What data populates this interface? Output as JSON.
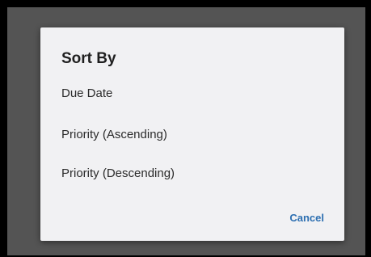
{
  "dialog": {
    "title": "Sort By",
    "options": [
      {
        "label": "Due Date"
      },
      {
        "label": "Priority (Ascending)"
      },
      {
        "label": "Priority (Descending)"
      }
    ],
    "cancel_label": "Cancel"
  },
  "colors": {
    "frame": "#000000",
    "backdrop": "#545454",
    "dialog_bg": "#f1f1f3",
    "title_text": "#1f1f1f",
    "option_text": "#2b2b2b",
    "accent": "#2d6fb1"
  }
}
